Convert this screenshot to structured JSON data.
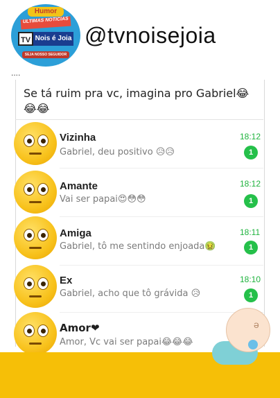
{
  "channel": {
    "handle": "@tvnoisejoia",
    "logo_top": "Humor",
    "logo_news": "ULTIMAS NOTICIAS",
    "logo_tv": "TV",
    "logo_name": "Nois é Joia",
    "logo_seja": "SEJA NOSSO SEGUIDOR"
  },
  "ellipsis": "....",
  "headline": "Se tá ruim pra vc, imagina pro Gabriel😂😂😂",
  "chats": [
    {
      "name": "Vizinha",
      "preview": "Gabriel, deu positivo 😥😥",
      "time": "18:12",
      "unread": "1"
    },
    {
      "name": "Amante",
      "preview": "Vai ser papai😍😳😳",
      "time": "18:12",
      "unread": "1"
    },
    {
      "name": "Amiga",
      "preview": "Gabriel, tô me sentindo enjoada🤢",
      "time": "18:11",
      "unread": "1"
    },
    {
      "name": "Ex",
      "preview": "Gabriel, acho que tô grávida 😥",
      "time": "18:10",
      "unread": "1"
    },
    {
      "name": "Amor❤",
      "preview": "Amor, Vc vai ser papai😂😂😂",
      "time": "",
      "unread": ""
    }
  ],
  "colors": {
    "accent": "#25c04a",
    "time": "#1eb33d",
    "bottom_strip": "#f6bf07"
  }
}
